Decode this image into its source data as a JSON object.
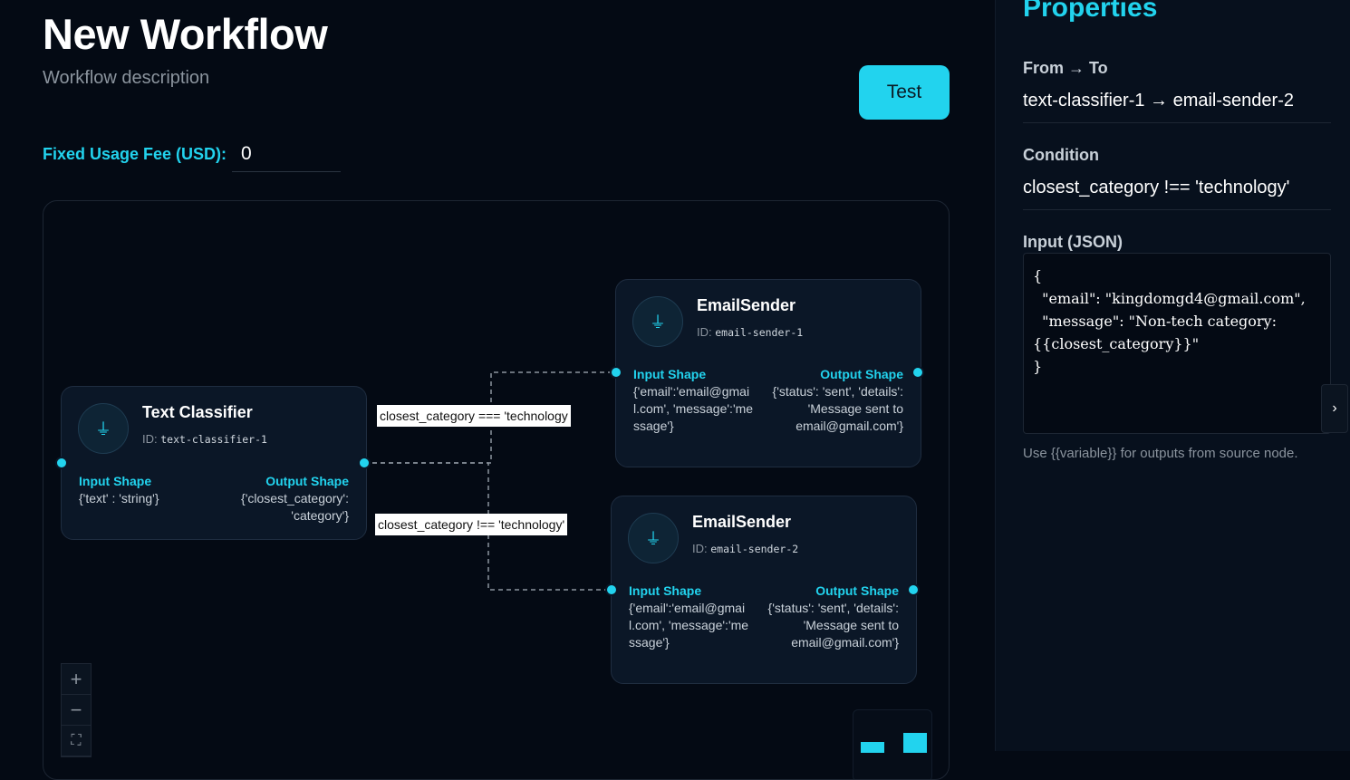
{
  "header": {
    "title": "New Workflow",
    "description": "Workflow description",
    "test_button": "Test",
    "fee_label": "Fixed Usage Fee (USD):",
    "fee_value": "0"
  },
  "nodes": [
    {
      "title": "Text Classifier",
      "id_label": "ID:",
      "id": "text-classifier-1",
      "icon": "plug-icon",
      "input_label": "Input Shape",
      "input_shape": "{'text' : 'string'}",
      "output_label": "Output Shape",
      "output_shape": "{'closest_category': 'category'}"
    },
    {
      "title": "EmailSender",
      "id_label": "ID:",
      "id": "email-sender-1",
      "icon": "plug-icon",
      "input_label": "Input Shape",
      "input_shape": "{'email':'email@gmail.com', 'message':'message'}",
      "output_label": "Output Shape",
      "output_shape": "{'status': 'sent', 'details': 'Message sent to email@gmail.com'}"
    },
    {
      "title": "EmailSender",
      "id_label": "ID:",
      "id": "email-sender-2",
      "icon": "plug-icon",
      "input_label": "Input Shape",
      "input_shape": "{'email':'email@gmail.com', 'message':'message'}",
      "output_label": "Output Shape",
      "output_shape": "{'status': 'sent', 'details': 'Message sent to email@gmail.com'}"
    }
  ],
  "edges": [
    {
      "label": "closest_category === 'technology"
    },
    {
      "label": "closest_category !== 'technology'"
    }
  ],
  "zoom_controls": {
    "plus": "+",
    "minus": "−",
    "fit": "⛶"
  },
  "properties": {
    "title": "Properties",
    "from_to_label": "From → To",
    "from_to_value": "text-classifier-1 → email-sender-2",
    "condition_label": "Condition",
    "condition_value": "closest_category !== 'technology'",
    "input_label": "Input (JSON)",
    "input_json": "{\n  \"email\": \"kingdomgd4@gmail.com\",\n  \"message\": \"Non-tech category: {{closest_category}}\"\n}",
    "hint": "Use {{variable}} for outputs from source node.",
    "collapse_icon": "chevron-right-icon"
  },
  "colors": {
    "accent": "#22d3ee",
    "background": "#040a14",
    "node_bg": "#0b1727"
  }
}
